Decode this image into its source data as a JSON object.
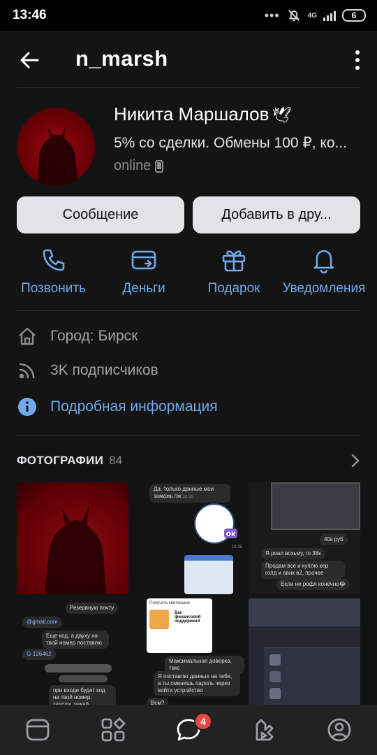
{
  "status_bar": {
    "time": "13:46",
    "network": "4G",
    "battery": "6"
  },
  "header": {
    "title": "n_marsh"
  },
  "profile": {
    "name": "Никита Маршалов",
    "name_emoji": "🕊",
    "status": "5% со сделки. Обмены 100 ₽, ко...",
    "online": "online"
  },
  "buttons": {
    "message": "Сообщение",
    "add_friend": "Добавить в дру..."
  },
  "actions": [
    {
      "label": "Позвонить",
      "icon": "phone-icon"
    },
    {
      "label": "Деньги",
      "icon": "card-icon"
    },
    {
      "label": "Подарок",
      "icon": "gift-icon"
    },
    {
      "label": "Уведомления",
      "icon": "bell-icon"
    }
  ],
  "info": {
    "city": "Город: Бирск",
    "followers": "3K подписчиков",
    "more": "Подробная информация"
  },
  "photos": {
    "title": "ФОТОГРАФИИ",
    "count": "84",
    "ph2": {
      "msg": "Да, только данные мои замажь пж",
      "time1": "18:26",
      "sticker_text": "ок",
      "time2": "18:35"
    },
    "ph3": {
      "m1": "40к руб",
      "m2": "Я реал возьму, го 38к",
      "m3": "Продам все и куплю кер голд и авик в2, прочее",
      "m4": "Если не рофл конечно😂"
    },
    "ph4": {
      "m1": "Резервную почту",
      "m2": "@gmail.com",
      "m3": "Еще код, а двуху на твой номер поставлю",
      "m4": "G-126462",
      "m5": "при входе будет код на твой номер, заходи, чекай"
    },
    "ph5": {
      "m1": "Получить квитанцию",
      "m2": "Вас финансовой поддержкой",
      "m3": "Максимальная доверка, такс",
      "m4": "Я поставлю данные на тебя, а ты сменишь пароль через войти устройство",
      "m5": "Всм?"
    }
  },
  "tabbar": {
    "messages_badge": "4"
  },
  "colors": {
    "accent": "#71aaeb",
    "background": "#141414",
    "button_bg": "#e1e3e6",
    "badge": "#e64646"
  }
}
